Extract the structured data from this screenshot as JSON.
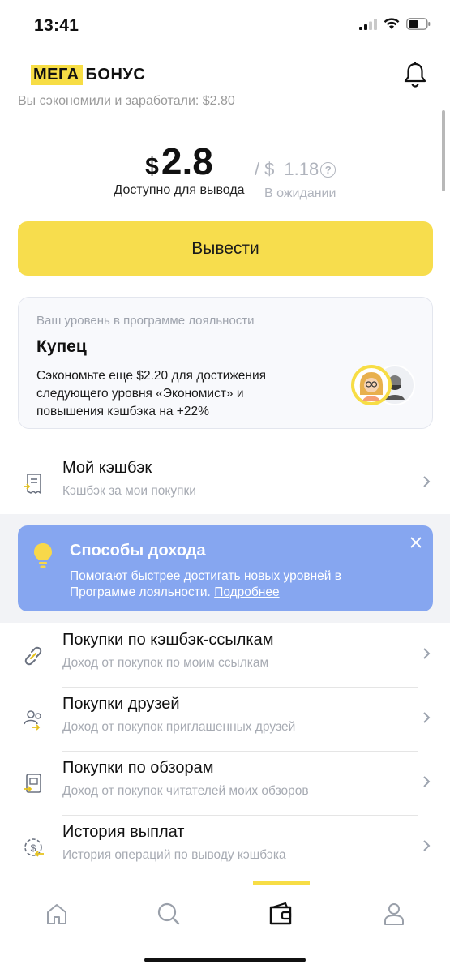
{
  "status_bar": {
    "time": "13:41"
  },
  "header": {
    "logo_part1": "МЕГА",
    "logo_part2": "БОНУС"
  },
  "scrolled_text": "Вы сэкономили и заработали: $2.80",
  "balance": {
    "available_currency": "$",
    "available_value": "2.8",
    "available_label": "Доступно для вывода",
    "pending_separator": "/",
    "pending_currency": "$",
    "pending_value": "1.18",
    "pending_help": "?",
    "pending_label": "В ожидании"
  },
  "withdraw_button": "Вывести",
  "loyalty": {
    "caption": "Ваш уровень в программе лояльности",
    "level": "Купец",
    "description": "Сэкономьте еще $2.20 для достижения следующего уровня «Экономист» и повышения кэшбэка на +22%"
  },
  "menu_cashback": {
    "title": "Мой кэшбэк",
    "subtitle": "Кэшбэк за мои покупки",
    "icon": "receipt-icon"
  },
  "income_banner": {
    "title": "Способы дохода",
    "text": "Помогают быстрее достигать новых уровней в Программе лояльности.",
    "link": "Подробнее",
    "accent": "#86a6f0"
  },
  "menu_items": [
    {
      "title": "Покупки по кэшбэк-ссылкам",
      "subtitle": "Доход от покупок по моим ссылкам",
      "icon": "link-icon"
    },
    {
      "title": "Покупки друзей",
      "subtitle": "Доход от покупок приглашенных друзей",
      "icon": "friends-icon"
    },
    {
      "title": "Покупки по обзорам",
      "subtitle": "Доход от покупок читателей моих обзоров",
      "icon": "reviews-icon"
    },
    {
      "title": "История выплат",
      "subtitle": "История операций по выводу кэшбэка",
      "icon": "payout-history-icon"
    }
  ],
  "bottom_nav": {
    "items": [
      "home-icon",
      "search-icon",
      "wallet-icon",
      "profile-icon"
    ],
    "active": "wallet-icon"
  },
  "colors": {
    "brand_yellow": "#f7dd45",
    "muted": "#a7abb3"
  }
}
